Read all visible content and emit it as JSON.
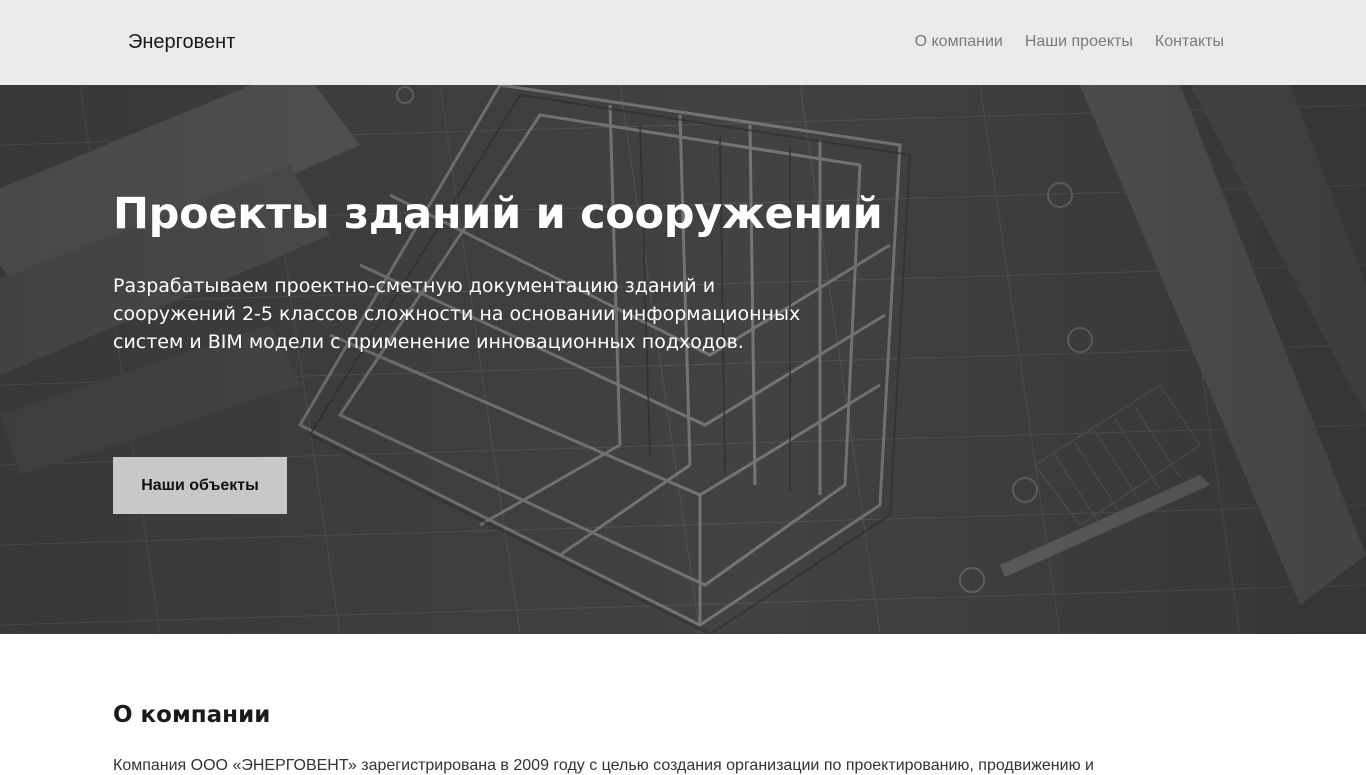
{
  "header": {
    "brand": "Энерговент",
    "nav": [
      {
        "label": "О компании"
      },
      {
        "label": "Наши проекты"
      },
      {
        "label": "Контакты"
      }
    ]
  },
  "hero": {
    "title": "Проекты зданий и сооружений",
    "description": "Разрабатываем проектно-сметную документацию зданий и сооружений 2-5 классов сложности на основании информационных систем и BIM модели с применение инновационных подходов.",
    "button_label": "Наши объекты",
    "background_icon": "blueprint-illustration"
  },
  "about": {
    "title": "О компании",
    "text": "Компания ООО «ЭНЕРГОВЕНТ» зарегистрирована в 2009 году с целью создания организации по проектированию, продвижению и"
  },
  "colors": {
    "navbar_bg": "#eaebed",
    "hero_bg": "#3d3d3d",
    "button_bg": "#c8c8c8"
  }
}
